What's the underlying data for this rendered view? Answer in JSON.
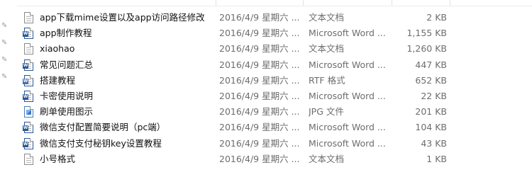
{
  "pins": [
    "pin-icon",
    "pin-icon",
    "pin-icon",
    "pin-icon"
  ],
  "files": [
    {
      "name": "app下载mime设置以及app访问路径修改",
      "date": "2016/4/9 星期六 ...",
      "type": "文本文档",
      "size": "2 KB",
      "icon": "text-file-icon"
    },
    {
      "name": "app制作教程",
      "date": "2016/4/9 星期六 ...",
      "type": "Microsoft Word ...",
      "size": "1,155 KB",
      "icon": "word-document-icon"
    },
    {
      "name": "xiaohao",
      "date": "2016/4/9 星期六 ...",
      "type": "文本文档",
      "size": "1,260 KB",
      "icon": "text-file-icon"
    },
    {
      "name": "常见问题汇总",
      "date": "2016/4/9 星期六 ...",
      "type": "Microsoft Word ...",
      "size": "447 KB",
      "icon": "word-document-icon"
    },
    {
      "name": "搭建教程",
      "date": "2016/4/9 星期六 ...",
      "type": "RTF 格式",
      "size": "652 KB",
      "icon": "rtf-document-icon"
    },
    {
      "name": "卡密使用说明",
      "date": "2016/4/9 星期六 ...",
      "type": "Microsoft Word ...",
      "size": "22 KB",
      "icon": "word-document-icon"
    },
    {
      "name": "刷单使用图示",
      "date": "2016/4/9 星期六 ...",
      "type": "JPG 文件",
      "size": "201 KB",
      "icon": "jpg-image-icon"
    },
    {
      "name": "微信支付配置简要说明（pc端）",
      "date": "2016/4/9 星期六 ...",
      "type": "Microsoft Word ...",
      "size": "104 KB",
      "icon": "word-document-icon"
    },
    {
      "name": "微信支付支付秘钥key设置教程",
      "date": "2016/4/9 星期六 ...",
      "type": "Microsoft Word ...",
      "size": "43 KB",
      "icon": "word-document-icon"
    },
    {
      "name": "小号格式",
      "date": "2016/4/9 星期六 ...",
      "type": "文本文档",
      "size": "1 KB",
      "icon": "text-file-icon"
    }
  ]
}
